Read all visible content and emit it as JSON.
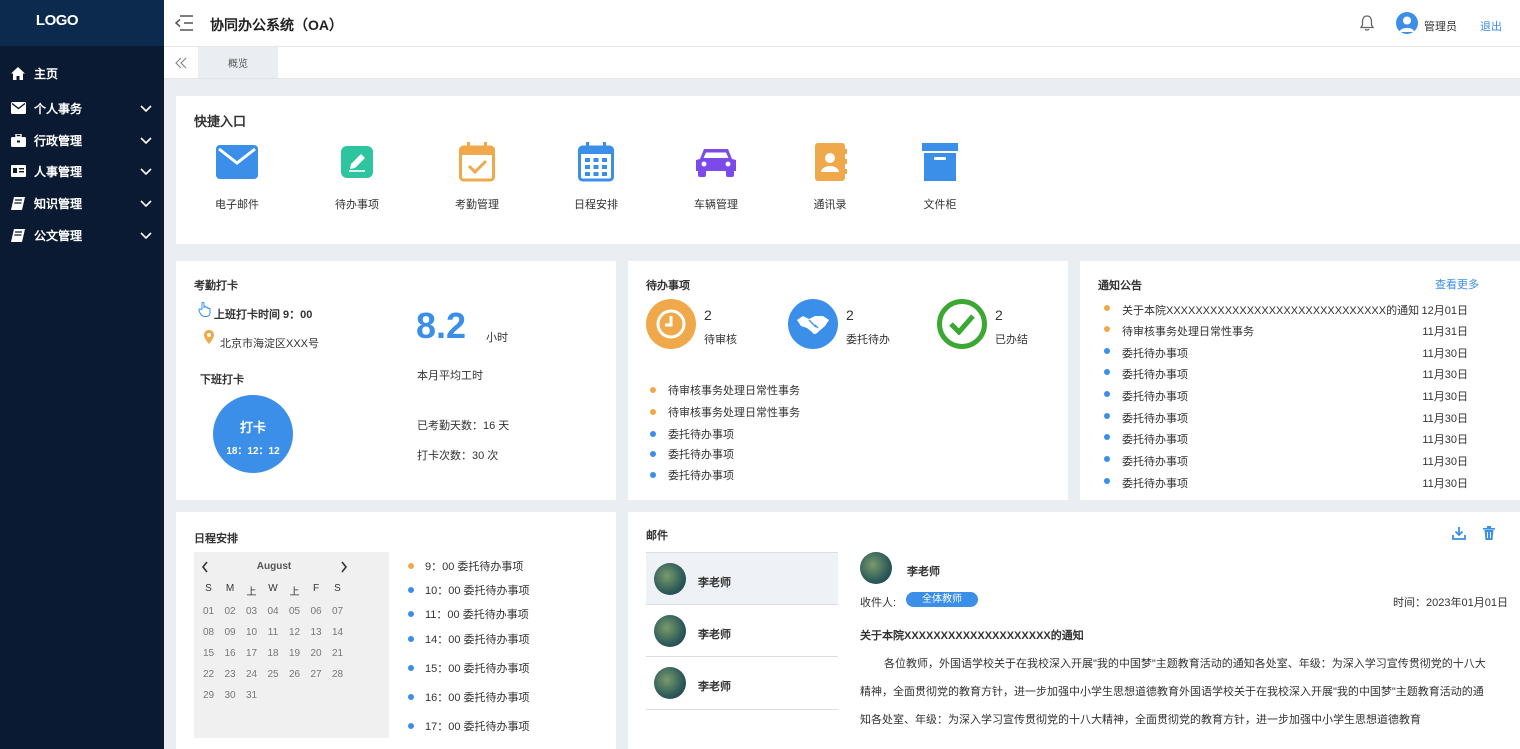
{
  "logo": "LOGO",
  "sidebar": {
    "items": [
      {
        "label": "主页",
        "icon": "home-icon"
      },
      {
        "label": "个人事务",
        "icon": "envelope-icon"
      },
      {
        "label": "行政管理",
        "icon": "briefcase-icon"
      },
      {
        "label": "人事管理",
        "icon": "id-card-icon"
      },
      {
        "label": "知识管理",
        "icon": "book-icon"
      },
      {
        "label": "公文管理",
        "icon": "book-icon"
      }
    ]
  },
  "header": {
    "title": "协同办公系统（OA）",
    "user": "管理员",
    "logout": "退出"
  },
  "tabs": [
    {
      "label": "概览"
    }
  ],
  "quick_entry": {
    "title": "快捷入口",
    "items": [
      {
        "label": "电子邮件",
        "icon": "mail-icon",
        "color": "#3b8fe8"
      },
      {
        "label": "待办事项",
        "icon": "pencil-icon",
        "color": "#2ec4a0"
      },
      {
        "label": "考勤管理",
        "icon": "calendar-check-icon",
        "color": "#f0a94a"
      },
      {
        "label": "日程安排",
        "icon": "calendar-grid-icon",
        "color": "#3b8fe8"
      },
      {
        "label": "车辆管理",
        "icon": "car-icon",
        "color": "#7b4ae8"
      },
      {
        "label": "通讯录",
        "icon": "contact-book-icon",
        "color": "#f0a94a"
      },
      {
        "label": "文件柜",
        "icon": "archive-box-icon",
        "color": "#3b8fe8"
      }
    ]
  },
  "attendance": {
    "title": "考勤打卡",
    "checkin_time": "上班打卡时间 9：00",
    "location": "北京市海淀区XXX号",
    "checkout_label": "下班打卡",
    "button_label": "打卡",
    "button_time": "18：12：12",
    "avg_hours": "8.2",
    "avg_unit": "小时",
    "avg_label": "本月平均工时",
    "days": "已考勤天数：16 天",
    "count": "打卡次数：30 次"
  },
  "todo": {
    "title": "待办事项",
    "stats": [
      {
        "num": "2",
        "label": "待审核",
        "color": "#f0a94a",
        "icon": "clock-icon"
      },
      {
        "num": "2",
        "label": "委托待办",
        "color": "#3b8fe8",
        "icon": "handshake-icon"
      },
      {
        "num": "2",
        "label": "已办结",
        "color": "#3aa832",
        "icon": "check-icon"
      }
    ],
    "list": [
      {
        "text": "待审核事务处理日常性事务",
        "color": "#f0a94a"
      },
      {
        "text": "待审核事务处理日常性事务",
        "color": "#f0a94a"
      },
      {
        "text": "委托待办事项",
        "color": "#3b8fe8"
      },
      {
        "text": "委托待办事项",
        "color": "#3b8fe8"
      },
      {
        "text": "委托待办事项",
        "color": "#3b8fe8"
      }
    ]
  },
  "notice": {
    "title": "通知公告",
    "more": "查看更多",
    "list": [
      {
        "text": "关于本院XXXXXXXXXXXXXXXXXXXXXXXXXXXXXX的通知",
        "date": "12月01日",
        "color": "#f0a94a"
      },
      {
        "text": "待审核事务处理日常性事务",
        "date": "11月31日",
        "color": "#f0a94a"
      },
      {
        "text": "委托待办事项",
        "date": "11月30日",
        "color": "#3b8fe8"
      },
      {
        "text": "委托待办事项",
        "date": "11月30日",
        "color": "#3b8fe8"
      },
      {
        "text": "委托待办事项",
        "date": "11月30日",
        "color": "#3b8fe8"
      },
      {
        "text": "委托待办事项",
        "date": "11月30日",
        "color": "#3b8fe8"
      },
      {
        "text": "委托待办事项",
        "date": "11月30日",
        "color": "#3b8fe8"
      },
      {
        "text": "委托待办事项",
        "date": "11月30日",
        "color": "#3b8fe8"
      },
      {
        "text": "委托待办事项",
        "date": "11月30日",
        "color": "#3b8fe8"
      }
    ]
  },
  "schedule": {
    "title": "日程安排",
    "calendar": {
      "month": "August",
      "weekdays": [
        "S",
        "M",
        "上",
        "W",
        "上",
        "F",
        "S"
      ],
      "days": [
        "01",
        "02",
        "03",
        "04",
        "05",
        "06",
        "07",
        "08",
        "09",
        "10",
        "11",
        "12",
        "13",
        "14",
        "15",
        "16",
        "17",
        "18",
        "19",
        "20",
        "21",
        "22",
        "23",
        "24",
        "25",
        "26",
        "27",
        "28",
        "29",
        "30",
        "31"
      ]
    },
    "items": [
      {
        "text": "9：00 委托待办事项",
        "color": "#f0a94a"
      },
      {
        "text": "10：00 委托待办事项",
        "color": "#3b8fe8"
      },
      {
        "text": "11：00 委托待办事项",
        "color": "#3b8fe8"
      },
      {
        "text": "14：00 委托待办事项",
        "color": "#3b8fe8"
      },
      {
        "text": "15：00 委托待办事项",
        "color": "#3b8fe8"
      },
      {
        "text": "16：00 委托待办事项",
        "color": "#3b8fe8"
      },
      {
        "text": "17：00 委托待办事项",
        "color": "#3b8fe8"
      }
    ]
  },
  "mail": {
    "title": "邮件",
    "list": [
      {
        "name": "李老师"
      },
      {
        "name": "李老师"
      },
      {
        "name": "李老师"
      }
    ],
    "detail": {
      "sender": "李老师",
      "recipient_label": "收件人:",
      "recipient": "全体教师",
      "time": "时间：2023年01月01日",
      "subject": "关于本院XXXXXXXXXXXXXXXXXXXX的通知",
      "body": "各位教师，外国语学校关于在我校深入开展\"我的中国梦\"主题教育活动的通知各处室、年级：为深入学习宣传贯彻党的十八大精神，全面贯彻党的教育方针，进一步加强中小学生思想道德教育外国语学校关于在我校深入开展\"我的中国梦\"主题教育活动的通知各处室、年级：为深入学习宣传贯彻党的十八大精神，全面贯彻党的教育方针，进一步加强中小学生思想道德教育"
    }
  }
}
